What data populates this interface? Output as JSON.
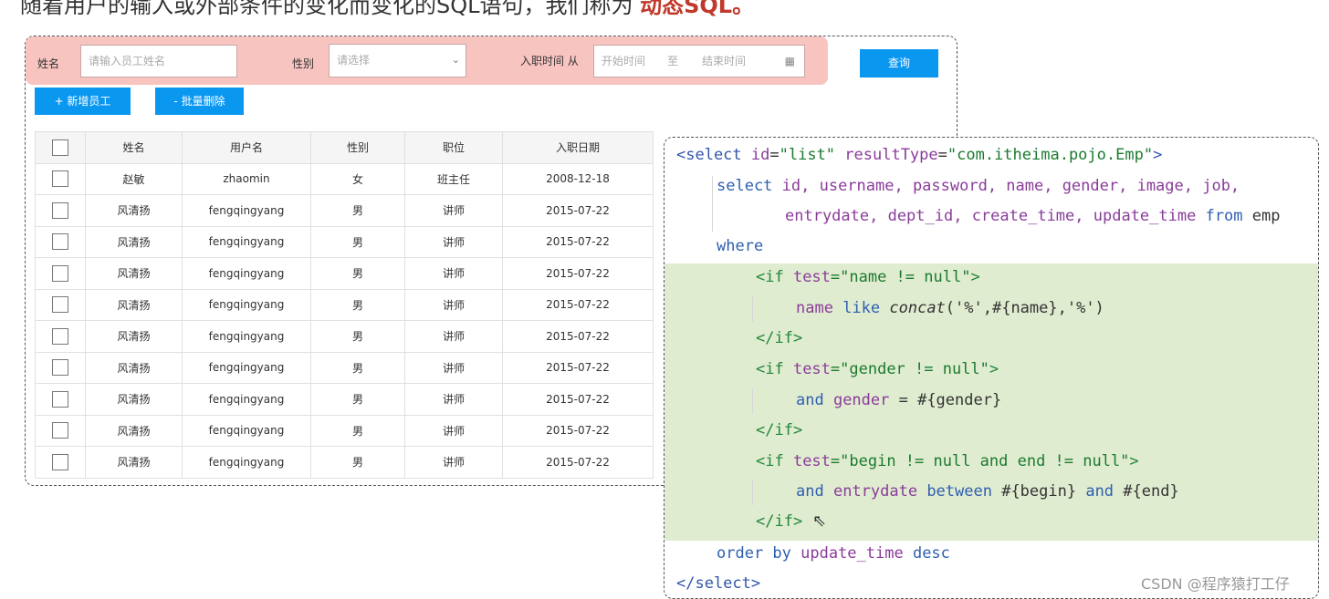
{
  "heading": {
    "text": "随着用户的输入或外部条件的变化而变化的SQL语句，我们称为 ",
    "highlight": "动态SQL。"
  },
  "search": {
    "name_label": "姓名",
    "name_placeholder": "请输入员工姓名",
    "gender_label": "性别",
    "gender_placeholder": "请选择",
    "date_label": "入职时间 从",
    "start_placeholder": "开始时间",
    "to": "至",
    "end_placeholder": "结束时间",
    "query_button": "查询"
  },
  "actions": {
    "add": "+ 新增员工",
    "batch_delete": "- 批量删除"
  },
  "table": {
    "columns": [
      "姓名",
      "用户名",
      "性别",
      "职位",
      "入职日期"
    ],
    "rows": [
      [
        "赵敏",
        "zhaomin",
        "女",
        "班主任",
        "2008-12-18"
      ],
      [
        "风清扬",
        "fengqingyang",
        "男",
        "讲师",
        "2015-07-22"
      ],
      [
        "风清扬",
        "fengqingyang",
        "男",
        "讲师",
        "2015-07-22"
      ],
      [
        "风清扬",
        "fengqingyang",
        "男",
        "讲师",
        "2015-07-22"
      ],
      [
        "风清扬",
        "fengqingyang",
        "男",
        "讲师",
        "2015-07-22"
      ],
      [
        "风清扬",
        "fengqingyang",
        "男",
        "讲师",
        "2015-07-22"
      ],
      [
        "风清扬",
        "fengqingyang",
        "男",
        "讲师",
        "2015-07-22"
      ],
      [
        "风清扬",
        "fengqingyang",
        "男",
        "讲师",
        "2015-07-22"
      ],
      [
        "风清扬",
        "fengqingyang",
        "男",
        "讲师",
        "2015-07-22"
      ],
      [
        "风清扬",
        "fengqingyang",
        "男",
        "讲师",
        "2015-07-22"
      ]
    ]
  },
  "code": {
    "l1a": "<select ",
    "l1b": "id",
    "l1c": "=",
    "l1d": "\"list\"",
    "l1e": " resultType",
    "l1f": "=",
    "l1g": "\"com.itheima.pojo.Emp\"",
    "l1h": ">",
    "l2a": "select ",
    "l2b": "id, username, password, name, gender, image, job,",
    "l3a": "entrydate, dept_id, create_time, update_time ",
    "l3b": "from",
    "l3c": " emp",
    "l4": "where",
    "l5a": "<if ",
    "l5b": "test",
    "l5c": "=\"name != null\"",
    "l5d": ">",
    "l6a": "name ",
    "l6b": "like ",
    "l6c": "concat",
    "l6d": "('%',#{name},'%')",
    "l7": "</if>",
    "l8a": "<if ",
    "l8b": "test",
    "l8c": "=\"gender != null\"",
    "l8d": ">",
    "l9a": "and ",
    "l9b": "gender",
    "l9c": " = #{gender}",
    "l10": "</if>",
    "l11a": "<if ",
    "l11b": "test",
    "l11c": "=\"begin != null and end != null\"",
    "l11d": ">",
    "l12a": "and ",
    "l12b": "entrydate",
    "l12c": " between ",
    "l12d": "#{begin} ",
    "l12e": "and",
    "l12f": " #{end}",
    "l13": "</if>",
    "l14a": "order by ",
    "l14b": "update_time ",
    "l14c": "desc",
    "l15": "</select>"
  },
  "watermark": "CSDN @程序猿打工仔"
}
